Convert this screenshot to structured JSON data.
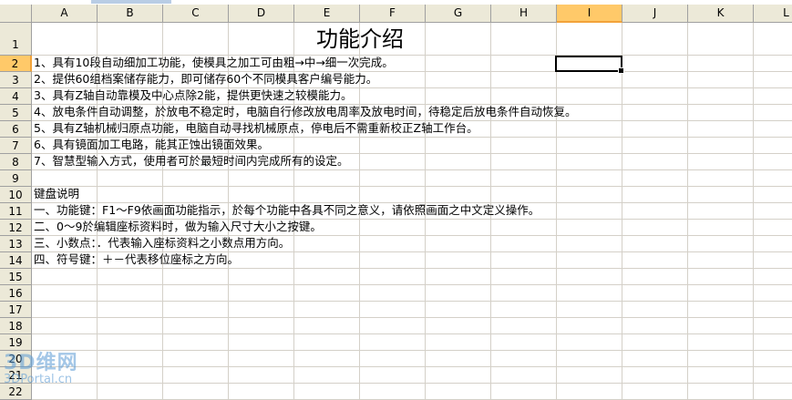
{
  "columns": [
    "A",
    "B",
    "C",
    "D",
    "E",
    "F",
    "G",
    "H",
    "I",
    "J",
    "K",
    "L"
  ],
  "active_column": "I",
  "rows": [
    "1",
    "2",
    "3",
    "4",
    "5",
    "6",
    "7",
    "8",
    "9",
    "10",
    "11",
    "12",
    "13",
    "14",
    "15",
    "16",
    "17",
    "18",
    "19",
    "20",
    "21",
    "22"
  ],
  "active_row": "2",
  "title": "功能介绍",
  "lines": [
    {
      "row": "2",
      "text": "1、具有10段自动细加工功能，使模具之加工可由粗→中→细一次完成。"
    },
    {
      "row": "3",
      "text": "2、提供60组档案储存能力，即可储存60个不同模具客户编号能力。"
    },
    {
      "row": "4",
      "text": "3、具有Z轴自动靠模及中心点除2能，提供更快速之较模能力。"
    },
    {
      "row": "5",
      "text": "4、放电条件自动调整，於放电不稳定时，电脑自行修改放电周率及放电时间，待稳定后放电条件自动恢复。"
    },
    {
      "row": "6",
      "text": "5、具有Z轴机械归原点功能，电脑自动寻找机械原点，停电后不需重新校正Z轴工作台。"
    },
    {
      "row": "7",
      "text": "6、具有镜面加工电路，能其正蚀出镜面效果。"
    },
    {
      "row": "8",
      "text": "7、智慧型输入方式，使用者可於最短时间内完成所有的设定。"
    },
    {
      "row": "10",
      "text": "键盘说明"
    },
    {
      "row": "11",
      "text": "一、功能键：F1～F9依画面功能指示，於每个功能中各具不同之意义，请依照画面之中文定义操作。"
    },
    {
      "row": "12",
      "text": "二、0～9於编辑座标资料时，做为输入尺寸大小之按键。"
    },
    {
      "row": "13",
      "text": "三、小数点：．代表输入座标资料之小数点用方向。"
    },
    {
      "row": "14",
      "text": "四、符号键：＋－代表移位座标之方向。"
    }
  ],
  "watermark": {
    "big": "3D维网",
    "small": "3DPortal.cn"
  },
  "colors": {
    "header_bg": "#ece9d8",
    "active_header": "#ffc969",
    "grid": "#d4d0c8"
  }
}
